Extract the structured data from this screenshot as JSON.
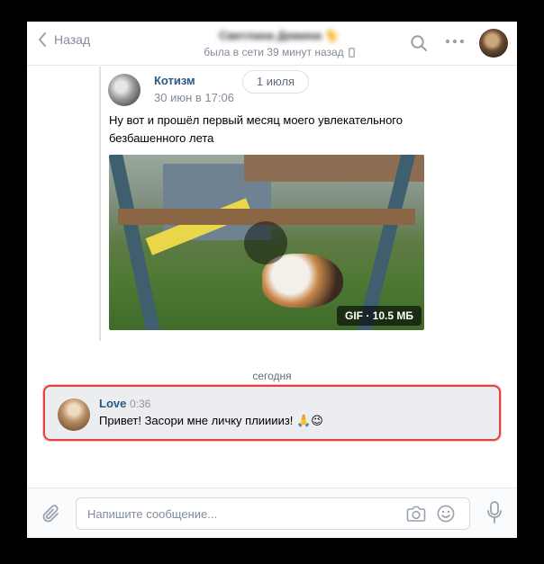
{
  "header": {
    "back_label": "Назад",
    "peer_name": "Светлана Демина 🐈",
    "peer_status": "была в сети 39 минут назад"
  },
  "forwarded_post": {
    "author": "Котизм",
    "date": "30 июн в 17:06",
    "date_pill": "1 июля",
    "text": "Ну вот и прошёл первый месяц моего увлекательного безбашенного лета",
    "gif_badge": "GIF · 10.5 МБ"
  },
  "day_separator": "сегодня",
  "message": {
    "author": "Love",
    "time": "0:36",
    "text": "Привет! Засори мне личку плииииз! 🙏😉"
  },
  "composer": {
    "placeholder": "Напишите сообщение..."
  },
  "icons": [
    "chevron-left-icon",
    "search-icon",
    "more-icon",
    "phone-icon",
    "play-icon",
    "paperclip-icon",
    "camera-icon",
    "smile-icon",
    "microphone-icon"
  ],
  "colors": {
    "link_blue": "#2a5885",
    "muted": "#818c99",
    "highlight_border": "#e0463f",
    "message_bg": "#ebedf0"
  }
}
